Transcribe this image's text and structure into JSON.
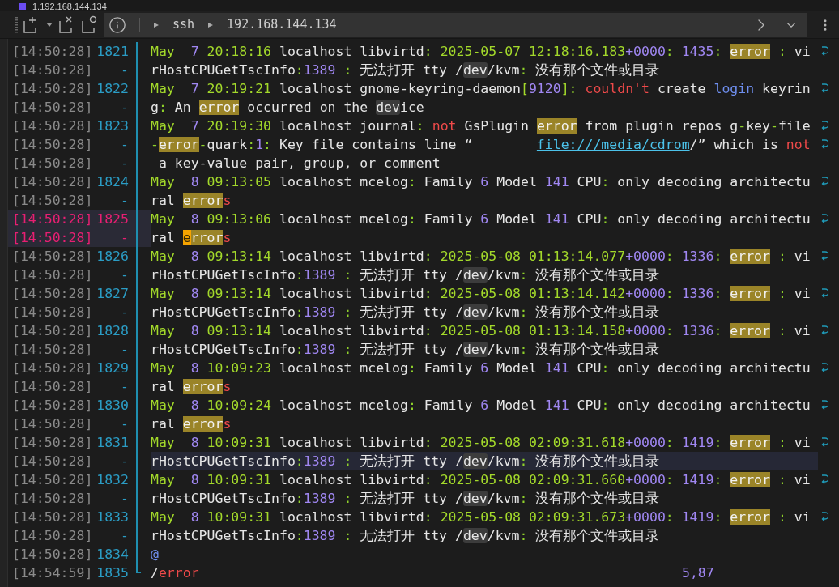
{
  "tab": {
    "title": "1.192.168.144.134"
  },
  "breadcrumb": [
    "ssh",
    "192.168.144.134"
  ],
  "rows": [
    {
      "time": "[14:50:28]",
      "number": "1821",
      "selected": false,
      "current": false,
      "wrapped": true,
      "segments": [
        {
          "kind": "date",
          "text": "May  "
        },
        {
          "kind": "num",
          "text": "7 "
        },
        {
          "kind": "date",
          "text": "20:18:16"
        },
        {
          "kind": "text",
          "text": " localhost libvirtd"
        },
        {
          "kind": "punct",
          "text": ": "
        },
        {
          "kind": "date",
          "text": "2025-05-07 12:18:16.183"
        },
        {
          "kind": "num",
          "text": "+0000"
        },
        {
          "kind": "punct",
          "text": ": "
        },
        {
          "kind": "num",
          "text": "1435"
        },
        {
          "kind": "punct",
          "text": ": "
        },
        {
          "kind": "match",
          "text": "error"
        },
        {
          "kind": "punct",
          "text": " : "
        },
        {
          "kind": "text",
          "text": "vi"
        }
      ]
    },
    {
      "time": "[14:50:28]",
      "number": "-",
      "selected": false,
      "current": false,
      "wrapped": false,
      "segments": [
        {
          "kind": "text",
          "text": "rHostCPUGetTscInfo"
        },
        {
          "kind": "punct",
          "text": ":"
        },
        {
          "kind": "num",
          "text": "1389 "
        },
        {
          "kind": "punct",
          "text": ": "
        },
        {
          "kind": "text",
          "text": "无法打开 tty /"
        },
        {
          "kind": "path",
          "text": "dev"
        },
        {
          "kind": "text",
          "text": "/kvm"
        },
        {
          "kind": "punct",
          "text": ": "
        },
        {
          "kind": "text",
          "text": "没有那个文件或目录"
        }
      ]
    },
    {
      "time": "[14:50:28]",
      "number": "1822",
      "selected": false,
      "current": false,
      "wrapped": true,
      "segments": [
        {
          "kind": "date",
          "text": "May  "
        },
        {
          "kind": "num",
          "text": "7 "
        },
        {
          "kind": "date",
          "text": "20:19:21"
        },
        {
          "kind": "text",
          "text": " localhost gnome-keyring-daemon"
        },
        {
          "kind": "date",
          "text": "["
        },
        {
          "kind": "num",
          "text": "9120"
        },
        {
          "kind": "date",
          "text": "]"
        },
        {
          "kind": "punct",
          "text": ": "
        },
        {
          "kind": "red",
          "text": "couldn't"
        },
        {
          "kind": "text",
          "text": " create "
        },
        {
          "kind": "kw",
          "text": "login"
        },
        {
          "kind": "text",
          "text": " keyrin"
        }
      ]
    },
    {
      "time": "[14:50:28]",
      "number": "-",
      "selected": false,
      "current": false,
      "wrapped": false,
      "segments": [
        {
          "kind": "text",
          "text": "g"
        },
        {
          "kind": "punct",
          "text": ":"
        },
        {
          "kind": "text",
          "text": " An "
        },
        {
          "kind": "match",
          "text": "error"
        },
        {
          "kind": "text",
          "text": " occurred on the "
        },
        {
          "kind": "path",
          "text": "dev"
        },
        {
          "kind": "text",
          "text": "ice"
        }
      ]
    },
    {
      "time": "[14:50:28]",
      "number": "1823",
      "selected": false,
      "current": false,
      "wrapped": true,
      "segments": [
        {
          "kind": "date",
          "text": "May  "
        },
        {
          "kind": "num",
          "text": "7 "
        },
        {
          "kind": "date",
          "text": "20:19:30"
        },
        {
          "kind": "text",
          "text": " localhost journal"
        },
        {
          "kind": "punct",
          "text": ": "
        },
        {
          "kind": "red",
          "text": "not"
        },
        {
          "kind": "text",
          "text": " GsPlugin "
        },
        {
          "kind": "match",
          "text": "error"
        },
        {
          "kind": "text",
          "text": " from plugin repos g"
        },
        {
          "kind": "punct",
          "text": "-"
        },
        {
          "kind": "text",
          "text": "key"
        },
        {
          "kind": "punct",
          "text": "-"
        },
        {
          "kind": "text",
          "text": "file"
        }
      ]
    },
    {
      "time": "[14:50:28]",
      "number": "-",
      "selected": false,
      "current": false,
      "wrapped": true,
      "segments": [
        {
          "kind": "punct",
          "text": "-"
        },
        {
          "kind": "match",
          "text": "error"
        },
        {
          "kind": "punct",
          "text": "-"
        },
        {
          "kind": "text",
          "text": "quark"
        },
        {
          "kind": "punct",
          "text": ":"
        },
        {
          "kind": "num",
          "text": "1"
        },
        {
          "kind": "punct",
          "text": ":"
        },
        {
          "kind": "text",
          "text": " Key file contains line “        "
        },
        {
          "kind": "link",
          "text": "file:///media/cdrom"
        },
        {
          "kind": "text",
          "text": "/” which is "
        },
        {
          "kind": "red",
          "text": "not"
        }
      ]
    },
    {
      "time": "[14:50:28]",
      "number": "-",
      "selected": false,
      "current": false,
      "wrapped": false,
      "segments": [
        {
          "kind": "text",
          "text": " a key-value pair, group, or comment"
        }
      ]
    },
    {
      "time": "[14:50:28]",
      "number": "1824",
      "selected": false,
      "current": false,
      "wrapped": true,
      "segments": [
        {
          "kind": "date",
          "text": "May  "
        },
        {
          "kind": "num",
          "text": "8 "
        },
        {
          "kind": "date",
          "text": "09:13:05"
        },
        {
          "kind": "text",
          "text": " localhost mcelog"
        },
        {
          "kind": "punct",
          "text": ": "
        },
        {
          "kind": "text",
          "text": "Family "
        },
        {
          "kind": "num",
          "text": "6"
        },
        {
          "kind": "text",
          "text": " Model "
        },
        {
          "kind": "num",
          "text": "141"
        },
        {
          "kind": "text",
          "text": " CPU"
        },
        {
          "kind": "punct",
          "text": ": "
        },
        {
          "kind": "text",
          "text": "only decoding architectu"
        }
      ]
    },
    {
      "time": "[14:50:28]",
      "number": "-",
      "selected": false,
      "current": false,
      "wrapped": false,
      "segments": [
        {
          "kind": "text",
          "text": "ral "
        },
        {
          "kind": "match",
          "text": "error"
        },
        {
          "kind": "red",
          "text": "s"
        }
      ]
    },
    {
      "time": "[14:50:28]",
      "number": "1825",
      "selected": true,
      "current": false,
      "wrapped": true,
      "segments": [
        {
          "kind": "date",
          "text": "May  "
        },
        {
          "kind": "num",
          "text": "8 "
        },
        {
          "kind": "date",
          "text": "09:13:06"
        },
        {
          "kind": "text",
          "text": " localhost mcelog"
        },
        {
          "kind": "punct",
          "text": ": "
        },
        {
          "kind": "text",
          "text": "Family "
        },
        {
          "kind": "num",
          "text": "6"
        },
        {
          "kind": "text",
          "text": " Model "
        },
        {
          "kind": "num",
          "text": "141"
        },
        {
          "kind": "text",
          "text": " CPU"
        },
        {
          "kind": "punct",
          "text": ": "
        },
        {
          "kind": "text",
          "text": "only decoding architectu"
        }
      ]
    },
    {
      "time": "[14:50:28]",
      "number": "-",
      "selected": true,
      "current": false,
      "wrapped": false,
      "segments": [
        {
          "kind": "text",
          "text": "ral "
        },
        {
          "kind": "cur",
          "text": "e"
        },
        {
          "kind": "match",
          "text": "rror"
        },
        {
          "kind": "red",
          "text": "s"
        }
      ]
    },
    {
      "time": "[14:50:28]",
      "number": "1826",
      "selected": false,
      "current": false,
      "wrapped": true,
      "segments": [
        {
          "kind": "date",
          "text": "May  "
        },
        {
          "kind": "num",
          "text": "8 "
        },
        {
          "kind": "date",
          "text": "09:13:14"
        },
        {
          "kind": "text",
          "text": " localhost libvirtd"
        },
        {
          "kind": "punct",
          "text": ": "
        },
        {
          "kind": "date",
          "text": "2025-05-08 01:13:14.077"
        },
        {
          "kind": "num",
          "text": "+0000"
        },
        {
          "kind": "punct",
          "text": ": "
        },
        {
          "kind": "num",
          "text": "1336"
        },
        {
          "kind": "punct",
          "text": ": "
        },
        {
          "kind": "match",
          "text": "error"
        },
        {
          "kind": "punct",
          "text": " : "
        },
        {
          "kind": "text",
          "text": "vi"
        }
      ]
    },
    {
      "time": "[14:50:28]",
      "number": "-",
      "selected": false,
      "current": false,
      "wrapped": false,
      "segments": [
        {
          "kind": "text",
          "text": "rHostCPUGetTscInfo"
        },
        {
          "kind": "punct",
          "text": ":"
        },
        {
          "kind": "num",
          "text": "1389 "
        },
        {
          "kind": "punct",
          "text": ": "
        },
        {
          "kind": "text",
          "text": "无法打开 tty /"
        },
        {
          "kind": "path",
          "text": "dev"
        },
        {
          "kind": "text",
          "text": "/kvm"
        },
        {
          "kind": "punct",
          "text": ": "
        },
        {
          "kind": "text",
          "text": "没有那个文件或目录"
        }
      ]
    },
    {
      "time": "[14:50:28]",
      "number": "1827",
      "selected": false,
      "current": false,
      "wrapped": true,
      "segments": [
        {
          "kind": "date",
          "text": "May  "
        },
        {
          "kind": "num",
          "text": "8 "
        },
        {
          "kind": "date",
          "text": "09:13:14"
        },
        {
          "kind": "text",
          "text": " localhost libvirtd"
        },
        {
          "kind": "punct",
          "text": ": "
        },
        {
          "kind": "date",
          "text": "2025-05-08 01:13:14.142"
        },
        {
          "kind": "num",
          "text": "+0000"
        },
        {
          "kind": "punct",
          "text": ": "
        },
        {
          "kind": "num",
          "text": "1336"
        },
        {
          "kind": "punct",
          "text": ": "
        },
        {
          "kind": "match",
          "text": "error"
        },
        {
          "kind": "punct",
          "text": " : "
        },
        {
          "kind": "text",
          "text": "vi"
        }
      ]
    },
    {
      "time": "[14:50:28]",
      "number": "-",
      "selected": false,
      "current": false,
      "wrapped": false,
      "segments": [
        {
          "kind": "text",
          "text": "rHostCPUGetTscInfo"
        },
        {
          "kind": "punct",
          "text": ":"
        },
        {
          "kind": "num",
          "text": "1389 "
        },
        {
          "kind": "punct",
          "text": ": "
        },
        {
          "kind": "text",
          "text": "无法打开 tty /"
        },
        {
          "kind": "path",
          "text": "dev"
        },
        {
          "kind": "text",
          "text": "/kvm"
        },
        {
          "kind": "punct",
          "text": ": "
        },
        {
          "kind": "text",
          "text": "没有那个文件或目录"
        }
      ]
    },
    {
      "time": "[14:50:28]",
      "number": "1828",
      "selected": false,
      "current": false,
      "wrapped": true,
      "segments": [
        {
          "kind": "date",
          "text": "May  "
        },
        {
          "kind": "num",
          "text": "8 "
        },
        {
          "kind": "date",
          "text": "09:13:14"
        },
        {
          "kind": "text",
          "text": " localhost libvirtd"
        },
        {
          "kind": "punct",
          "text": ": "
        },
        {
          "kind": "date",
          "text": "2025-05-08 01:13:14.158"
        },
        {
          "kind": "num",
          "text": "+0000"
        },
        {
          "kind": "punct",
          "text": ": "
        },
        {
          "kind": "num",
          "text": "1336"
        },
        {
          "kind": "punct",
          "text": ": "
        },
        {
          "kind": "match",
          "text": "error"
        },
        {
          "kind": "punct",
          "text": " : "
        },
        {
          "kind": "text",
          "text": "vi"
        }
      ]
    },
    {
      "time": "[14:50:28]",
      "number": "-",
      "selected": false,
      "current": false,
      "wrapped": false,
      "segments": [
        {
          "kind": "text",
          "text": "rHostCPUGetTscInfo"
        },
        {
          "kind": "punct",
          "text": ":"
        },
        {
          "kind": "num",
          "text": "1389 "
        },
        {
          "kind": "punct",
          "text": ": "
        },
        {
          "kind": "text",
          "text": "无法打开 tty /"
        },
        {
          "kind": "path",
          "text": "dev"
        },
        {
          "kind": "text",
          "text": "/kvm"
        },
        {
          "kind": "punct",
          "text": ": "
        },
        {
          "kind": "text",
          "text": "没有那个文件或目录"
        }
      ]
    },
    {
      "time": "[14:50:28]",
      "number": "1829",
      "selected": false,
      "current": false,
      "wrapped": true,
      "segments": [
        {
          "kind": "date",
          "text": "May  "
        },
        {
          "kind": "num",
          "text": "8 "
        },
        {
          "kind": "date",
          "text": "10:09:23"
        },
        {
          "kind": "text",
          "text": " localhost mcelog"
        },
        {
          "kind": "punct",
          "text": ": "
        },
        {
          "kind": "text",
          "text": "Family "
        },
        {
          "kind": "num",
          "text": "6"
        },
        {
          "kind": "text",
          "text": " Model "
        },
        {
          "kind": "num",
          "text": "141"
        },
        {
          "kind": "text",
          "text": " CPU"
        },
        {
          "kind": "punct",
          "text": ": "
        },
        {
          "kind": "text",
          "text": "only decoding architectu"
        }
      ]
    },
    {
      "time": "[14:50:28]",
      "number": "-",
      "selected": false,
      "current": false,
      "wrapped": false,
      "segments": [
        {
          "kind": "text",
          "text": "ral "
        },
        {
          "kind": "match",
          "text": "error"
        },
        {
          "kind": "red",
          "text": "s"
        }
      ]
    },
    {
      "time": "[14:50:28]",
      "number": "1830",
      "selected": false,
      "current": false,
      "wrapped": true,
      "segments": [
        {
          "kind": "date",
          "text": "May  "
        },
        {
          "kind": "num",
          "text": "8 "
        },
        {
          "kind": "date",
          "text": "10:09:24"
        },
        {
          "kind": "text",
          "text": " localhost mcelog"
        },
        {
          "kind": "punct",
          "text": ": "
        },
        {
          "kind": "text",
          "text": "Family "
        },
        {
          "kind": "num",
          "text": "6"
        },
        {
          "kind": "text",
          "text": " Model "
        },
        {
          "kind": "num",
          "text": "141"
        },
        {
          "kind": "text",
          "text": " CPU"
        },
        {
          "kind": "punct",
          "text": ": "
        },
        {
          "kind": "text",
          "text": "only decoding architectu"
        }
      ]
    },
    {
      "time": "[14:50:28]",
      "number": "-",
      "selected": false,
      "current": false,
      "wrapped": false,
      "segments": [
        {
          "kind": "text",
          "text": "ral "
        },
        {
          "kind": "match",
          "text": "error"
        },
        {
          "kind": "red",
          "text": "s"
        }
      ]
    },
    {
      "time": "[14:50:28]",
      "number": "1831",
      "selected": false,
      "current": false,
      "wrapped": true,
      "segments": [
        {
          "kind": "date",
          "text": "May  "
        },
        {
          "kind": "num",
          "text": "8 "
        },
        {
          "kind": "date",
          "text": "10:09:31"
        },
        {
          "kind": "text",
          "text": " localhost libvirtd"
        },
        {
          "kind": "punct",
          "text": ": "
        },
        {
          "kind": "date",
          "text": "2025-05-08 02:09:31.618"
        },
        {
          "kind": "num",
          "text": "+0000"
        },
        {
          "kind": "punct",
          "text": ": "
        },
        {
          "kind": "num",
          "text": "1419"
        },
        {
          "kind": "punct",
          "text": ": "
        },
        {
          "kind": "match",
          "text": "error"
        },
        {
          "kind": "punct",
          "text": " : "
        },
        {
          "kind": "text",
          "text": "vi"
        }
      ]
    },
    {
      "time": "[14:50:28]",
      "number": "-",
      "selected": false,
      "current": true,
      "wrapped": false,
      "segments": [
        {
          "kind": "text",
          "text": "rHostCPUGetTscInfo"
        },
        {
          "kind": "punct",
          "text": ":"
        },
        {
          "kind": "num",
          "text": "1389 "
        },
        {
          "kind": "punct",
          "text": ": "
        },
        {
          "kind": "text",
          "text": "无法打开 tty /"
        },
        {
          "kind": "path",
          "text": "dev"
        },
        {
          "kind": "text",
          "text": "/kvm"
        },
        {
          "kind": "punct",
          "text": ": "
        },
        {
          "kind": "text",
          "text": "没有那个文件或目录"
        }
      ]
    },
    {
      "time": "[14:50:28]",
      "number": "1832",
      "selected": false,
      "current": false,
      "wrapped": true,
      "segments": [
        {
          "kind": "date",
          "text": "May  "
        },
        {
          "kind": "num",
          "text": "8 "
        },
        {
          "kind": "date",
          "text": "10:09:31"
        },
        {
          "kind": "text",
          "text": " localhost libvirtd"
        },
        {
          "kind": "punct",
          "text": ": "
        },
        {
          "kind": "date",
          "text": "2025-05-08 02:09:31.660"
        },
        {
          "kind": "num",
          "text": "+0000"
        },
        {
          "kind": "punct",
          "text": ": "
        },
        {
          "kind": "num",
          "text": "1419"
        },
        {
          "kind": "punct",
          "text": ": "
        },
        {
          "kind": "match",
          "text": "error"
        },
        {
          "kind": "punct",
          "text": " : "
        },
        {
          "kind": "text",
          "text": "vi"
        }
      ]
    },
    {
      "time": "[14:50:28]",
      "number": "-",
      "selected": false,
      "current": false,
      "wrapped": false,
      "segments": [
        {
          "kind": "text",
          "text": "rHostCPUGetTscInfo"
        },
        {
          "kind": "punct",
          "text": ":"
        },
        {
          "kind": "num",
          "text": "1389 "
        },
        {
          "kind": "punct",
          "text": ": "
        },
        {
          "kind": "text",
          "text": "无法打开 tty /"
        },
        {
          "kind": "path",
          "text": "dev"
        },
        {
          "kind": "text",
          "text": "/kvm"
        },
        {
          "kind": "punct",
          "text": ": "
        },
        {
          "kind": "text",
          "text": "没有那个文件或目录"
        }
      ]
    },
    {
      "time": "[14:50:28]",
      "number": "1833",
      "selected": false,
      "current": false,
      "wrapped": true,
      "segments": [
        {
          "kind": "date",
          "text": "May  "
        },
        {
          "kind": "num",
          "text": "8 "
        },
        {
          "kind": "date",
          "text": "10:09:31"
        },
        {
          "kind": "text",
          "text": " localhost libvirtd"
        },
        {
          "kind": "punct",
          "text": ": "
        },
        {
          "kind": "date",
          "text": "2025-05-08 02:09:31.673"
        },
        {
          "kind": "num",
          "text": "+0000"
        },
        {
          "kind": "punct",
          "text": ": "
        },
        {
          "kind": "num",
          "text": "1419"
        },
        {
          "kind": "punct",
          "text": ": "
        },
        {
          "kind": "match",
          "text": "error"
        },
        {
          "kind": "punct",
          "text": " : "
        },
        {
          "kind": "text",
          "text": "vi"
        }
      ]
    },
    {
      "time": "[14:50:28]",
      "number": "-",
      "selected": false,
      "current": false,
      "wrapped": false,
      "segments": [
        {
          "kind": "text",
          "text": "rHostCPUGetTscInfo"
        },
        {
          "kind": "punct",
          "text": ":"
        },
        {
          "kind": "num",
          "text": "1389 "
        },
        {
          "kind": "punct",
          "text": ": "
        },
        {
          "kind": "text",
          "text": "无法打开 tty /"
        },
        {
          "kind": "path",
          "text": "dev"
        },
        {
          "kind": "text",
          "text": "/kvm"
        },
        {
          "kind": "punct",
          "text": ": "
        },
        {
          "kind": "text",
          "text": "没有那个文件或目录"
        }
      ]
    },
    {
      "time": "[14:50:28]",
      "number": "1834",
      "selected": false,
      "current": false,
      "wrapped": false,
      "segments": [
        {
          "kind": "kw",
          "text": "@"
        }
      ]
    },
    {
      "time": "[14:54:59]",
      "number": "1835",
      "selected": false,
      "current": false,
      "wrapped": false,
      "segments": [
        {
          "kind": "text",
          "text": "/"
        },
        {
          "kind": "red",
          "text": "error"
        }
      ]
    }
  ],
  "status": "5,87"
}
